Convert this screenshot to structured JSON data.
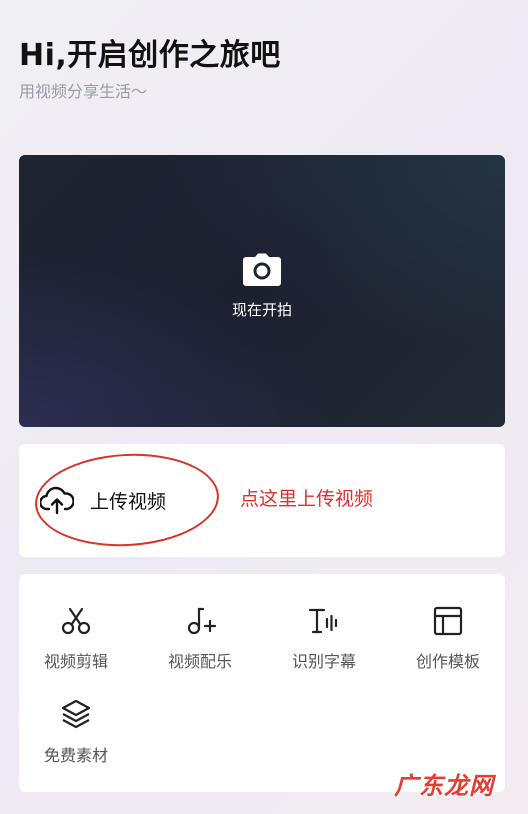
{
  "header": {
    "greeting": "Hi,开启创作之旅吧",
    "subtitle": "用视频分享生活～"
  },
  "camera": {
    "icon": "camera-icon",
    "label": "现在开拍"
  },
  "upload": {
    "icon": "cloud-upload-icon",
    "label": "上传视频",
    "annotation": "点这里上传视频"
  },
  "tools": [
    {
      "icon": "scissors-icon",
      "label": "视频剪辑"
    },
    {
      "icon": "music-note-plus-icon",
      "label": "视频配乐"
    },
    {
      "icon": "text-audio-icon",
      "label": "识别字幕"
    },
    {
      "icon": "template-layout-icon",
      "label": "创作模板"
    },
    {
      "icon": "layers-icon",
      "label": "免费素材"
    }
  ],
  "watermark": "广东龙网",
  "colors": {
    "annotation_red": "#e0302a",
    "camera_card_bg": "#1f2433"
  }
}
